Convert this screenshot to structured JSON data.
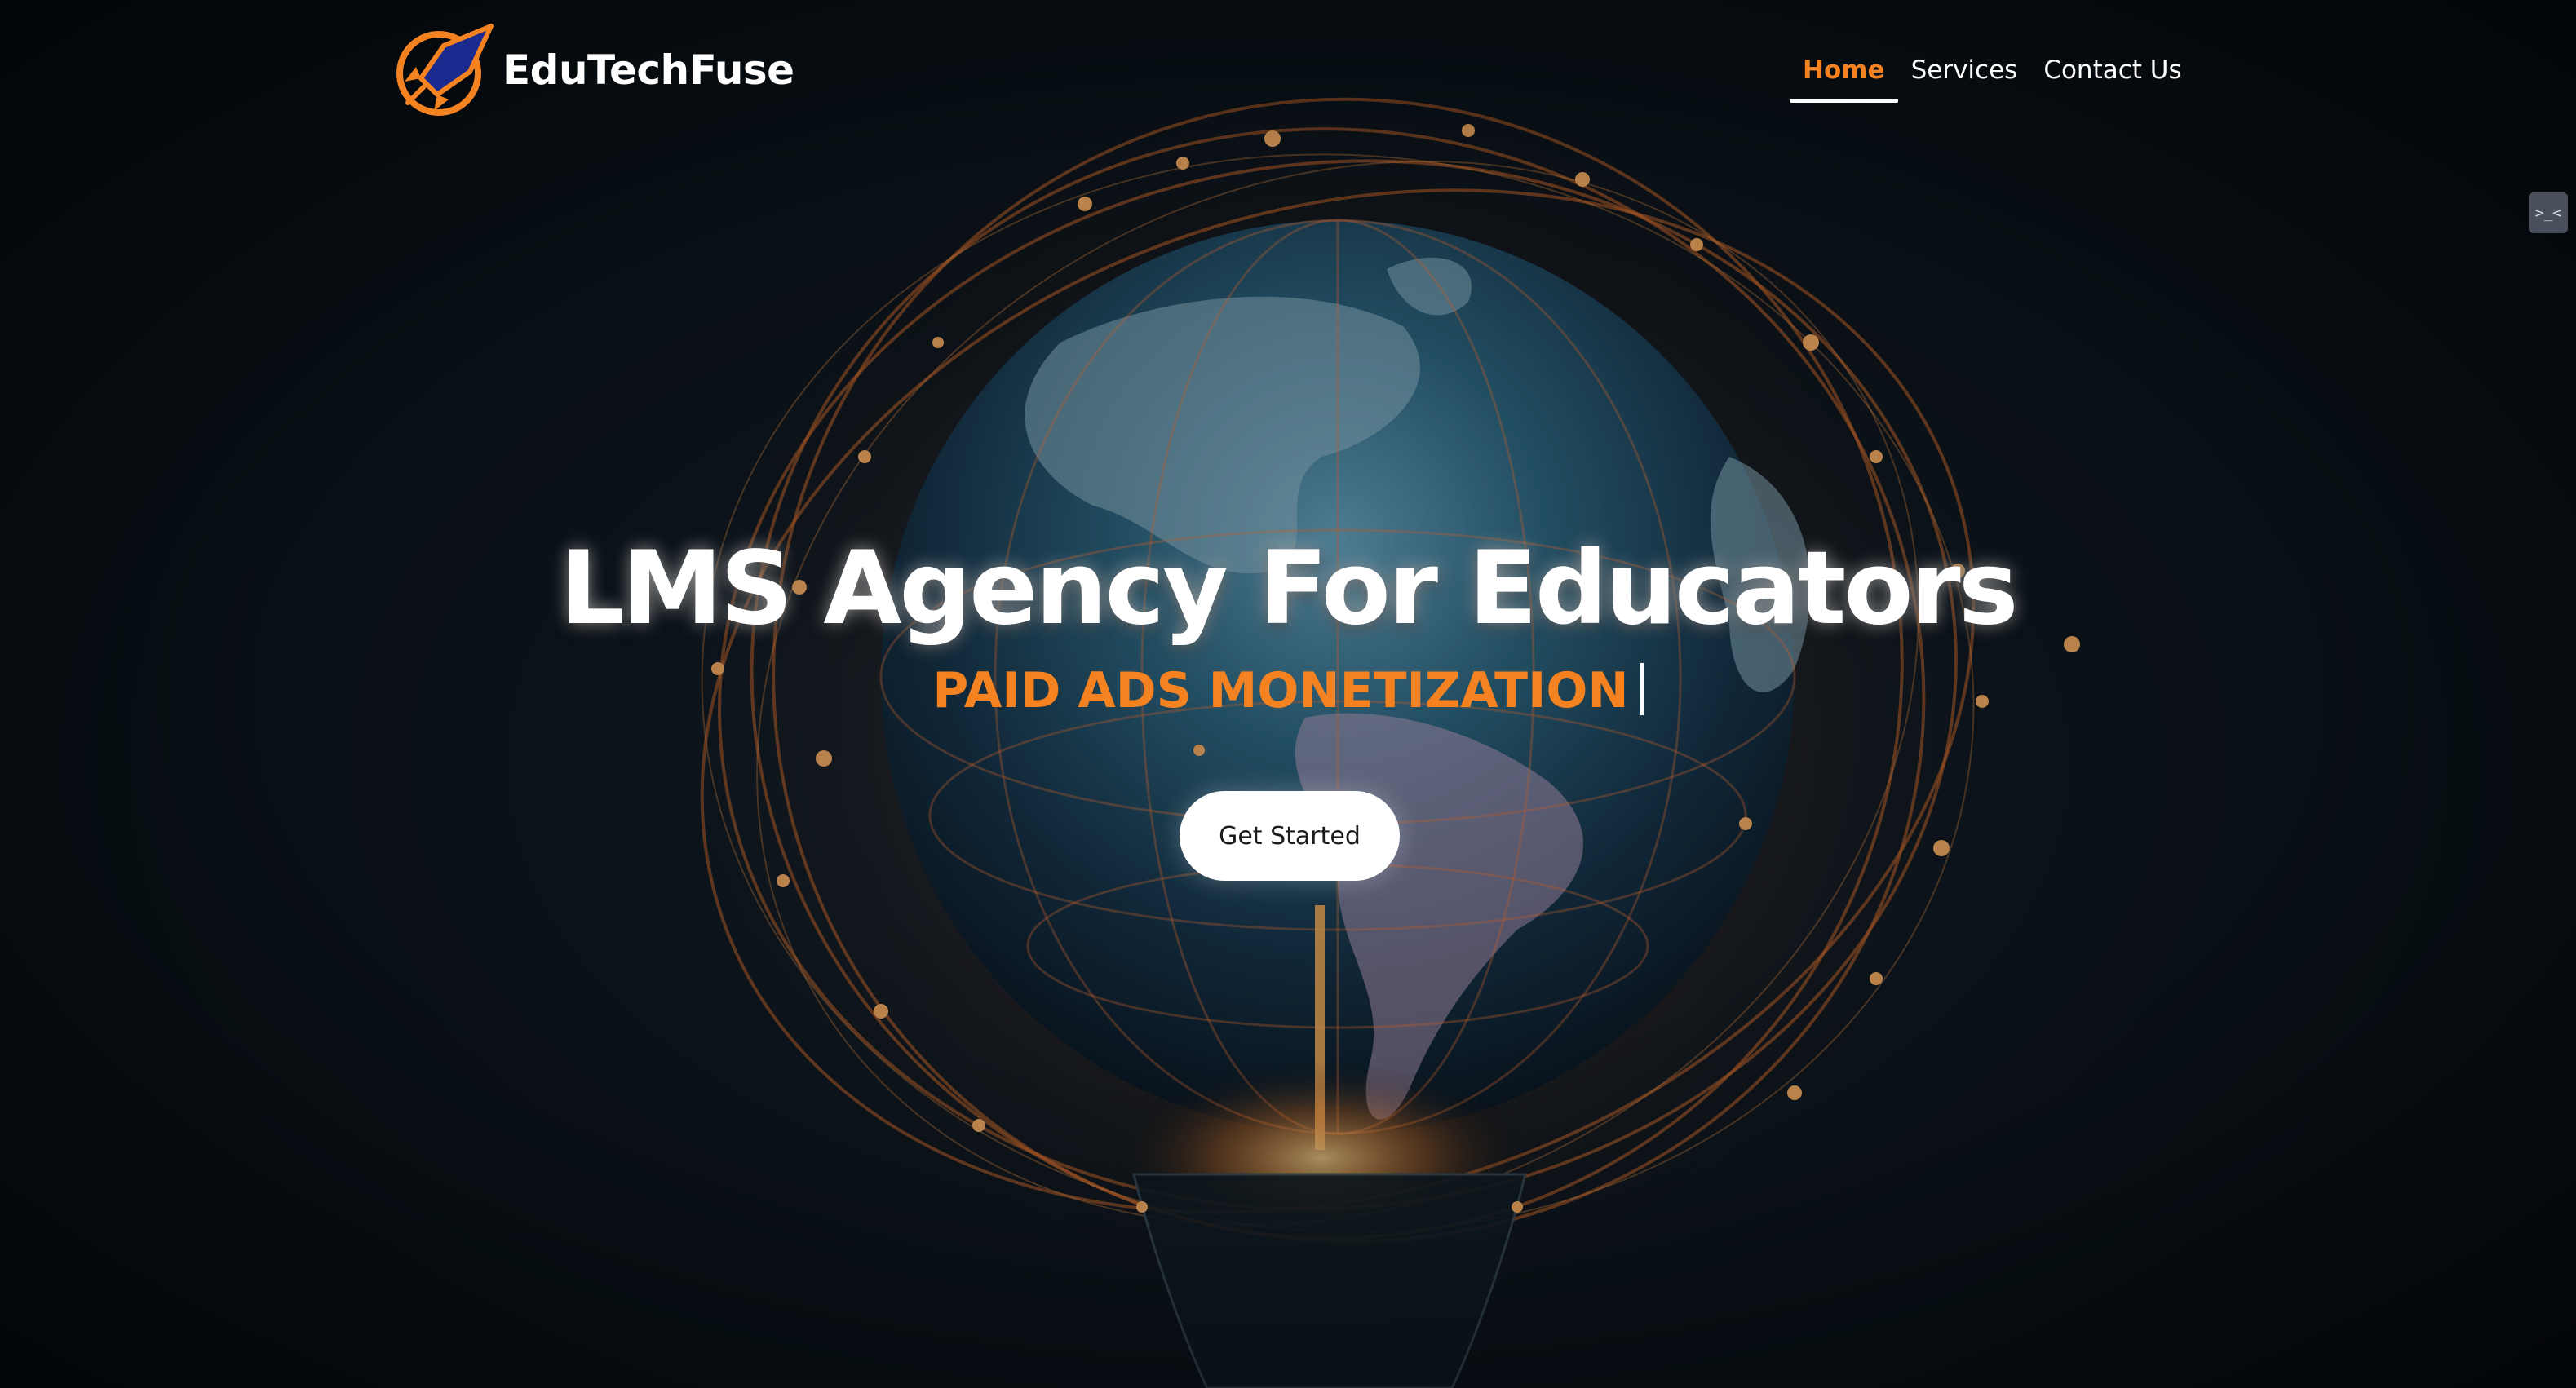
{
  "brand": {
    "name": "EduTechFuse",
    "logo_icon": "rocket-icon"
  },
  "nav": {
    "items": [
      {
        "label": "Home",
        "active": true
      },
      {
        "label": "Services",
        "active": false
      },
      {
        "label": "Contact Us",
        "active": false
      }
    ]
  },
  "hero": {
    "title": "LMS Agency For Educators",
    "subtitle": "PAID ADS MONETIZATION",
    "cta_label": "Get Started"
  },
  "side_widget": {
    "glyph": ">_<",
    "icon": "code-icon"
  },
  "colors": {
    "accent": "#f58220",
    "background": "#0b1117",
    "text": "#ffffff"
  }
}
